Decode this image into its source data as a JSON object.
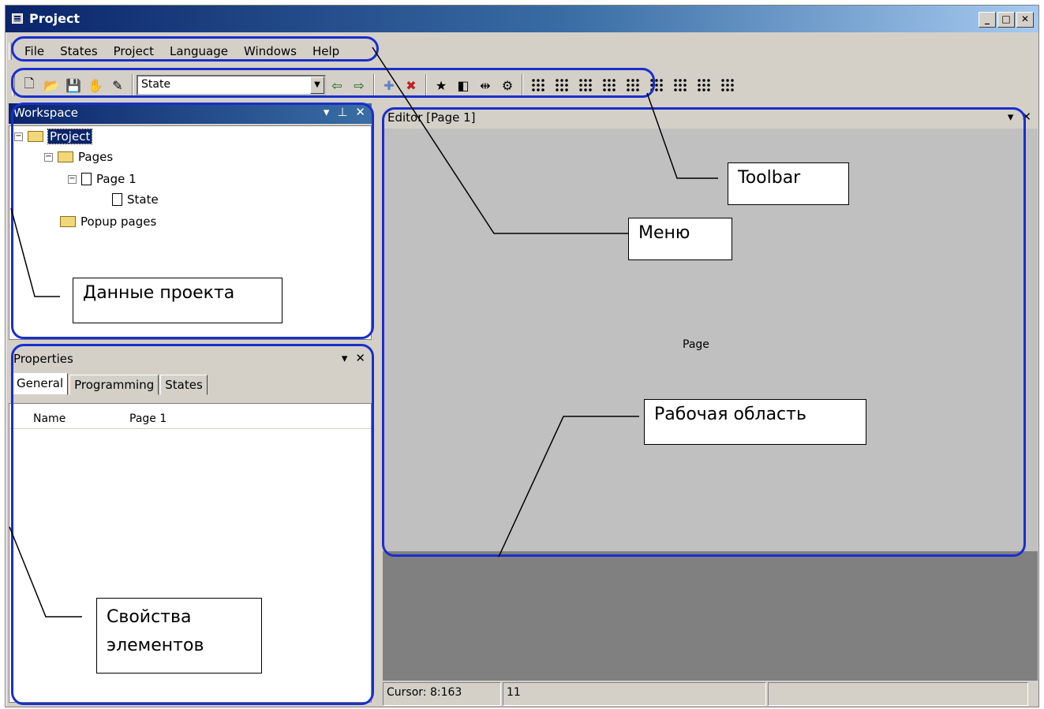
{
  "window": {
    "title": "Project"
  },
  "menu": [
    "File",
    "States",
    "Project",
    "Language",
    "Windows",
    "Help"
  ],
  "toolbar": {
    "state_select_value": "State"
  },
  "workspace": {
    "title": "Workspace",
    "tree": [
      "Project",
      "Pages",
      "Page 1",
      "State",
      "Popup pages"
    ]
  },
  "properties": {
    "title": "Properties",
    "tabs": [
      "General",
      "Programming",
      "States"
    ],
    "rows": [
      {
        "name": "Name",
        "value": "Page 1"
      }
    ]
  },
  "editor": {
    "title": "Editor [Page 1]",
    "canvas_label": "Page"
  },
  "status": {
    "cursor": "Cursor: 8:163",
    "value": "11"
  },
  "callouts": {
    "toolbar": "Toolbar",
    "menu": "Меню",
    "project_data": "Данные проекта",
    "workspace_area": "Рабочая область",
    "element_props_line1": "Свойства",
    "element_props_line2": "элементов"
  },
  "colors": {
    "highlight": "#1a2ecc",
    "titlebar": "#0a246a"
  }
}
